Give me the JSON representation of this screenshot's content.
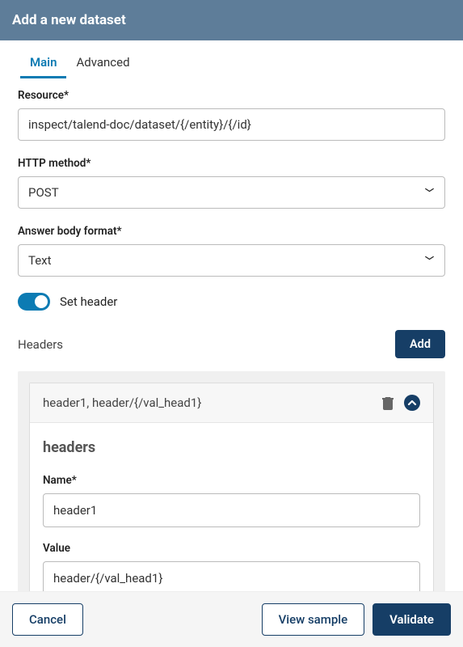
{
  "header": {
    "title": "Add a new dataset"
  },
  "tabs": {
    "main": "Main",
    "advanced": "Advanced"
  },
  "fields": {
    "resource_label": "Resource*",
    "resource_value": "inspect/talend-doc/dataset/{/entity}/{/id}",
    "http_method_label": "HTTP method*",
    "http_method_value": "POST",
    "answer_body_label": "Answer body format*",
    "answer_body_value": "Text",
    "set_header_label": "Set header"
  },
  "headers": {
    "section_label": "Headers",
    "add_label": "Add",
    "item": {
      "summary": "header1, header/{/val_head1}",
      "panel_title": "headers",
      "name_label": "Name*",
      "name_value": "header1",
      "value_label": "Value",
      "value_value": "header/{/val_head1}"
    }
  },
  "footer": {
    "cancel": "Cancel",
    "view_sample": "View sample",
    "validate": "Validate"
  }
}
